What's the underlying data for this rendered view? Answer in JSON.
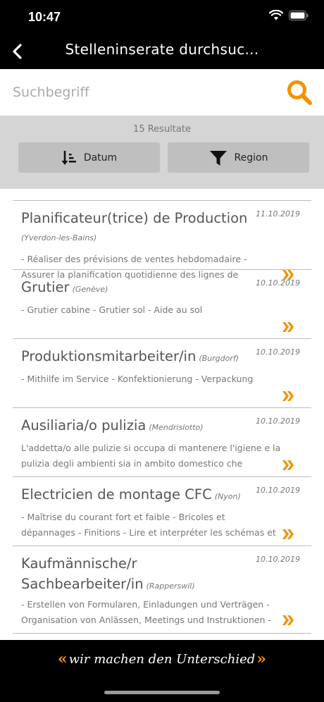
{
  "status_bar": {
    "time": "10:47"
  },
  "nav": {
    "title": "Stelleninserate durchsuc..."
  },
  "search": {
    "placeholder": "Suchbegriff",
    "value": ""
  },
  "filter": {
    "result_count": "15 Resultate",
    "sort_label": "Datum",
    "region_label": "Region"
  },
  "jobs": [
    {
      "title": "Planificateur(trice) de Production",
      "location": "(Yverdon-les-Bains)",
      "date": "11.10.2019",
      "description": "- Réaliser des prévisions de ventes hebdomadaire - Assurer la planification quotidienne des lignes de production - Editer"
    },
    {
      "title": "Grutier",
      "location": "(Genève)",
      "date": "10.10.2019",
      "description": "- Grutier cabine - Grutier sol - Aide au sol"
    },
    {
      "title": "Produktionsmitarbeiter/in",
      "location": "(Burgdorf)",
      "date": "10.10.2019",
      "description": "- Mithilfe im Service - Konfektionierung - Verpackung"
    },
    {
      "title": "Ausiliaria/o pulizia",
      "location": "(Mendrisiotto)",
      "date": "10.10.2019",
      "description": "L'addetta/o alle pulizie si occupa di mantenere l'igiene e la pulizia degli ambienti sia in ambito domestico che"
    },
    {
      "title": "Electricien de montage CFC",
      "location": "(Nyon)",
      "date": "10.10.2019",
      "description": "- Maîtrise du courant fort et faible - Bricoles et dépannages - Finitions - Lire et interpréter les schémas et les plans - Pose"
    },
    {
      "title": "Kaufmännische/r Sachbearbeiter/in",
      "location": "(Rapperswil)",
      "date": "10.10.2019",
      "description": "- Erstellen von Formularen, Einladungen und Verträgen - Organisation von Anlässen, Meetings und Instruktionen -"
    }
  ],
  "footer": {
    "slogan": "wir machen den Unterschied",
    "open_mark": "«",
    "close_mark": "»"
  },
  "colors": {
    "accent": "#f39200",
    "bar": "#000000",
    "filter_bg": "#d5d5d5",
    "button_bg": "#bfbfbf"
  }
}
